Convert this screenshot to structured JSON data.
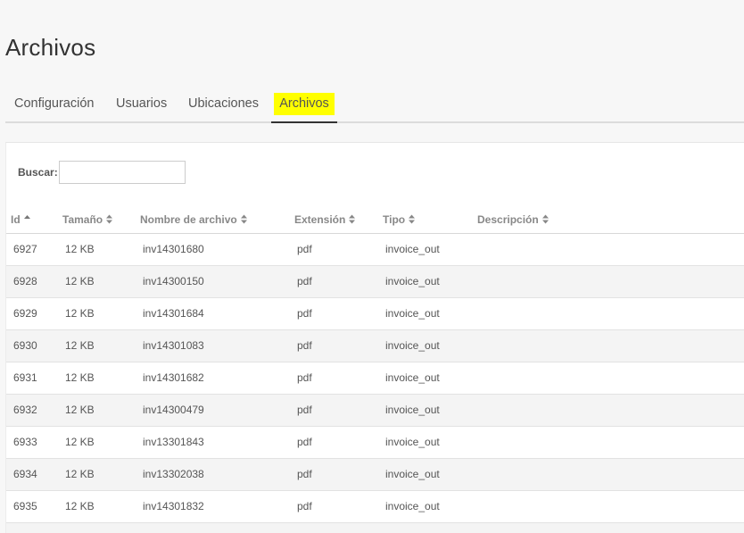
{
  "page": {
    "title": "Archivos"
  },
  "tabs": [
    {
      "label": "Configuración",
      "active": false
    },
    {
      "label": "Usuarios",
      "active": false
    },
    {
      "label": "Ubicaciones",
      "active": false
    },
    {
      "label": "Archivos",
      "active": true
    }
  ],
  "search": {
    "label": "Buscar:",
    "value": ""
  },
  "table": {
    "columns": [
      {
        "label": "Id",
        "sort": "asc"
      },
      {
        "label": "Tamaño",
        "sort": "both"
      },
      {
        "label": "Nombre de archivo",
        "sort": "both"
      },
      {
        "label": "Extensión",
        "sort": "both"
      },
      {
        "label": "Tipo",
        "sort": "both"
      },
      {
        "label": "Descripción",
        "sort": "both"
      }
    ],
    "rows": [
      [
        "6927",
        "12 KB",
        "inv14301680",
        "pdf",
        "invoice_out",
        ""
      ],
      [
        "6928",
        "12 KB",
        "inv14300150",
        "pdf",
        "invoice_out",
        ""
      ],
      [
        "6929",
        "12 KB",
        "inv14301684",
        "pdf",
        "invoice_out",
        ""
      ],
      [
        "6930",
        "12 KB",
        "inv14301083",
        "pdf",
        "invoice_out",
        ""
      ],
      [
        "6931",
        "12 KB",
        "inv14301682",
        "pdf",
        "invoice_out",
        ""
      ],
      [
        "6932",
        "12 KB",
        "inv14300479",
        "pdf",
        "invoice_out",
        ""
      ],
      [
        "6933",
        "12 KB",
        "inv13301843",
        "pdf",
        "invoice_out",
        ""
      ],
      [
        "6934",
        "12 KB",
        "inv13302038",
        "pdf",
        "invoice_out",
        ""
      ],
      [
        "6935",
        "12 KB",
        "inv14301832",
        "pdf",
        "invoice_out",
        ""
      ]
    ]
  },
  "colors": {
    "active_tab_highlight": "#ffff00",
    "active_tab_underline": "#333333",
    "row_alt_background": "#f4f4f4"
  }
}
